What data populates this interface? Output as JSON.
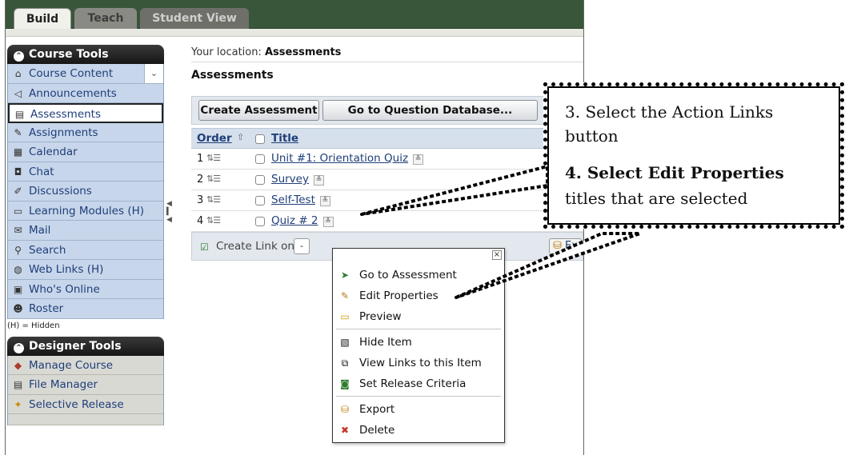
{
  "tabs": {
    "build": "Build",
    "teach": "Teach",
    "student_view": "Student View"
  },
  "sidebar": {
    "course_tools_header": "Course Tools",
    "course_tools": [
      {
        "label": "Course Content",
        "icon": "home-icon"
      },
      {
        "label": "Announcements",
        "icon": "megaphone-icon"
      },
      {
        "label": "Assessments",
        "icon": "assessment-icon"
      },
      {
        "label": "Assignments",
        "icon": "assignment-icon"
      },
      {
        "label": "Calendar",
        "icon": "calendar-icon"
      },
      {
        "label": "Chat",
        "icon": "chat-icon"
      },
      {
        "label": "Discussions",
        "icon": "discussion-icon"
      },
      {
        "label": "Learning Modules (H)",
        "icon": "module-icon"
      },
      {
        "label": "Mail",
        "icon": "mail-icon"
      },
      {
        "label": "Search",
        "icon": "search-icon"
      },
      {
        "label": "Web Links (H)",
        "icon": "web-links-icon"
      },
      {
        "label": "Who's Online",
        "icon": "whos-online-icon"
      },
      {
        "label": "Roster",
        "icon": "roster-icon"
      }
    ],
    "hidden_note": "(H) = Hidden",
    "designer_tools_header": "Designer Tools",
    "designer_tools": [
      {
        "label": "Manage Course",
        "icon": "manage-course-icon"
      },
      {
        "label": "File Manager",
        "icon": "file-manager-icon"
      },
      {
        "label": "Selective Release",
        "icon": "selective-release-icon"
      }
    ]
  },
  "main": {
    "location_prefix": "Your location:",
    "location": "Assessments",
    "title": "Assessments",
    "buttons": {
      "create": "Create Assessment",
      "question_db": "Go to Question Database..."
    },
    "table": {
      "col_order": "Order",
      "col_title": "Title",
      "rows": [
        {
          "num": "1",
          "title": "Unit #1: Orientation Quiz"
        },
        {
          "num": "2",
          "title": "Survey"
        },
        {
          "num": "3",
          "title": "Self-Test"
        },
        {
          "num": "4",
          "title": "Quiz # 2"
        }
      ]
    },
    "create_link_label": "Create Link on:",
    "create_link_value": "-",
    "export_button": "Ex"
  },
  "context_menu": {
    "close": "×",
    "items": [
      {
        "label": "Go to Assessment",
        "icon": "arrow-right-icon"
      },
      {
        "label": "Edit Properties",
        "icon": "pencil-icon"
      },
      {
        "label": "Preview",
        "icon": "preview-icon"
      },
      {
        "label": "Hide Item",
        "icon": "hide-icon"
      },
      {
        "label": "View Links to this Item",
        "icon": "links-icon"
      },
      {
        "label": "Set Release Criteria",
        "icon": "release-criteria-icon"
      },
      {
        "label": "Export",
        "icon": "export-icon"
      },
      {
        "label": "Delete",
        "icon": "delete-icon"
      }
    ]
  },
  "callout": {
    "line1": "3. Select the Action Links",
    "line2": "button",
    "line3": "4. Select Edit Properties",
    "line4": "titles that are selected"
  }
}
